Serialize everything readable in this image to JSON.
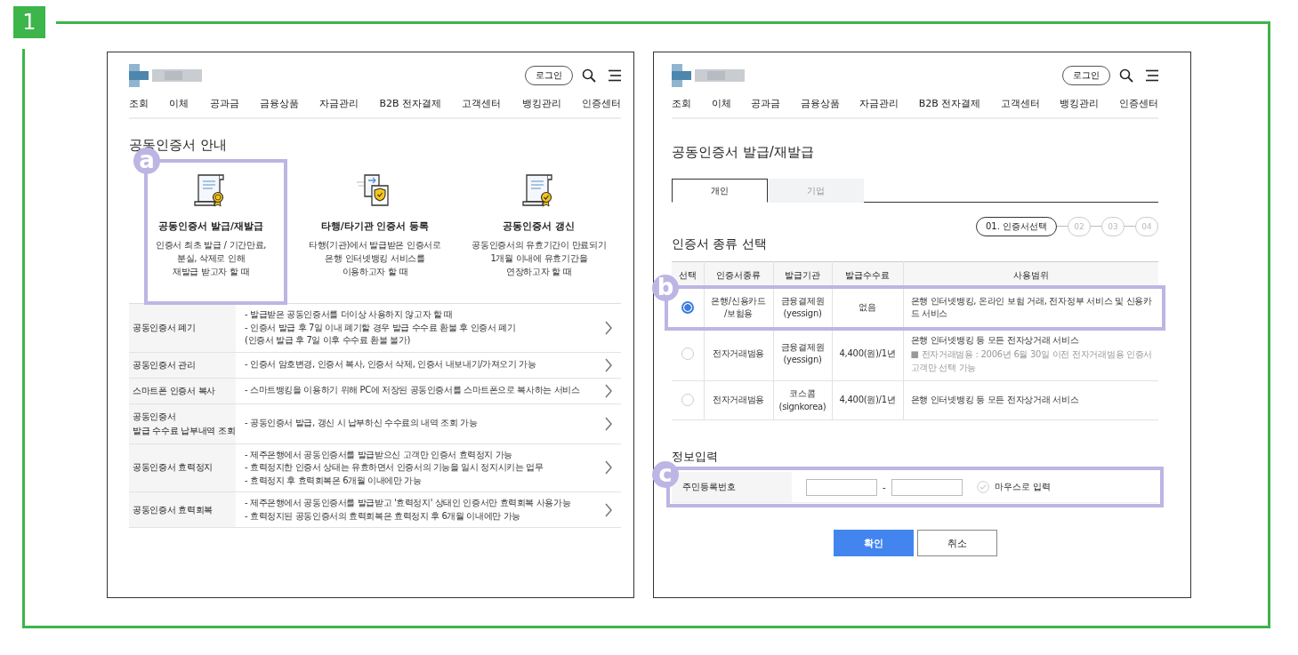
{
  "badge": "1",
  "left_panel": {
    "header": {
      "login": "로그인",
      "nav": [
        "조회",
        "이체",
        "공과금",
        "금융상품",
        "자금관리",
        "B2B 전자결제",
        "고객센터",
        "뱅킹관리",
        "인증센터"
      ]
    },
    "title": "공동인증서 안내",
    "cards": [
      {
        "kind": "issue",
        "title": "공동인증서 발급/재발급",
        "description": "인증서 최초 발급 / 기간만료,\n분실, 삭제로 인해\n재발급 받고자 할 때",
        "marker": "a"
      },
      {
        "kind": "register",
        "title": "타행/타기관 인증서 등록",
        "description": "타행(기관)에서 발급받은 인증서로\n은행 인터넷뱅킹 서비스를\n이용하고자 할 때"
      },
      {
        "kind": "renew",
        "title": "공동인증서 갱신",
        "description": "공동인증서의 유효기간이 만료되기\n1개월 이내에 유효기간을\n연장하고자 할 때"
      }
    ],
    "services": [
      {
        "label": "공동인증서 폐기",
        "lines": [
          "- 발급받은 공동인증서를 더이상 사용하지 않고자 할 때",
          "- 인증서 발급 후 7일 이내 폐기할 경우 발급 수수료 환불 후 인증서 폐기\n(인증서 발급 후 7일 이후 수수료 환불 불가)"
        ]
      },
      {
        "label": "공동인증서 관리",
        "lines": [
          "- 인증서 암호변경, 인증서 복사, 인증서 삭제, 인증서 내보내기/가져오기 가능"
        ]
      },
      {
        "label": "스마트폰 인증서 복사",
        "lines": [
          "- 스마트뱅킹을 이용하기 위해 PC에 저장된 공동인증서를 스마트폰으로 복사하는 서비스"
        ]
      },
      {
        "label": "공동인증서\n발급 수수료 납부내역 조회",
        "lines": [
          "- 공동인증서 발급, 갱신 시 납부하신 수수료의 내역 조회 가능"
        ]
      },
      {
        "label": "공동인증서 효력정지",
        "lines": [
          "- 제주은행에서 공동인증서를 발급받으신 고객만 인증서 효력정지 가능",
          "- 효력정지한 인증서 상태는 유효하면서 인증서의 기능을 일시 정지시키는 업무",
          "- 효력정지 후 효력회복은 6개월 이내에만 가능"
        ]
      },
      {
        "label": "공동인증서 효력회복",
        "lines": [
          "- 제주은행에서 공동인증서를 발급받고 '효력정지' 상태인 인증서만 효력회복 사용가능",
          "- 효력정지된 공동인증서의 효력회복은 효력정지 후 6개월 이내에만 가능"
        ]
      }
    ]
  },
  "right_panel": {
    "header": {
      "login": "로그인",
      "nav": [
        "조회",
        "이체",
        "공과금",
        "금융상품",
        "자금관리",
        "B2B 전자결제",
        "고객센터",
        "뱅킹관리",
        "인증센터"
      ]
    },
    "title": "공동인증서 발급/재발급",
    "tabs": [
      {
        "label": "개인",
        "selected": true
      },
      {
        "label": "기업",
        "selected": false
      }
    ],
    "steps": [
      {
        "label": "01. 인증서선택",
        "selected": true
      },
      {
        "label": "02",
        "selected": false
      },
      {
        "label": "03",
        "selected": false
      },
      {
        "label": "04",
        "selected": false
      }
    ],
    "section_title": "인증서 종류 선택",
    "table": {
      "columns": [
        "선택",
        "인증서종류",
        "발급기관",
        "발급수수료",
        "사용범위"
      ],
      "rows": [
        {
          "selected": true,
          "type": "은행/신용카드\n/보험용",
          "issuer": "금융결제원\n(yessign)",
          "fee": "없음",
          "usage": "은행 인터넷뱅킹, 온라인 보험 거래, 전자정부 서비스 및 신용카드 서비스",
          "marker": "b"
        },
        {
          "selected": false,
          "type": "전자거래범용",
          "issuer": "금융결제원\n(yessign)",
          "fee": "4,400(원)/1년",
          "usage": "은행 인터넷뱅킹 등 모든 전자상거래 서비스",
          "note": "■ 전자거래범용 : 2006년 6월 30일 이전 전자거래범용 인증서 고객만 선택 가능"
        },
        {
          "selected": false,
          "type": "전자거래범용",
          "issuer": "코스콤\n(signkorea)",
          "fee": "4,400(원)/1년",
          "usage": "은행 인터넷뱅킹 등 모든 전자상거래 서비스"
        }
      ]
    },
    "info": {
      "title": "정보입력",
      "marker": "c",
      "field_label": "주민등록번호",
      "separator": "-",
      "mouse_input": {
        "label": "마우스로 입력",
        "checked": false
      }
    },
    "buttons": [
      {
        "label": "확인",
        "kind": "primary"
      },
      {
        "label": "취소",
        "kind": "secondary"
      }
    ]
  }
}
